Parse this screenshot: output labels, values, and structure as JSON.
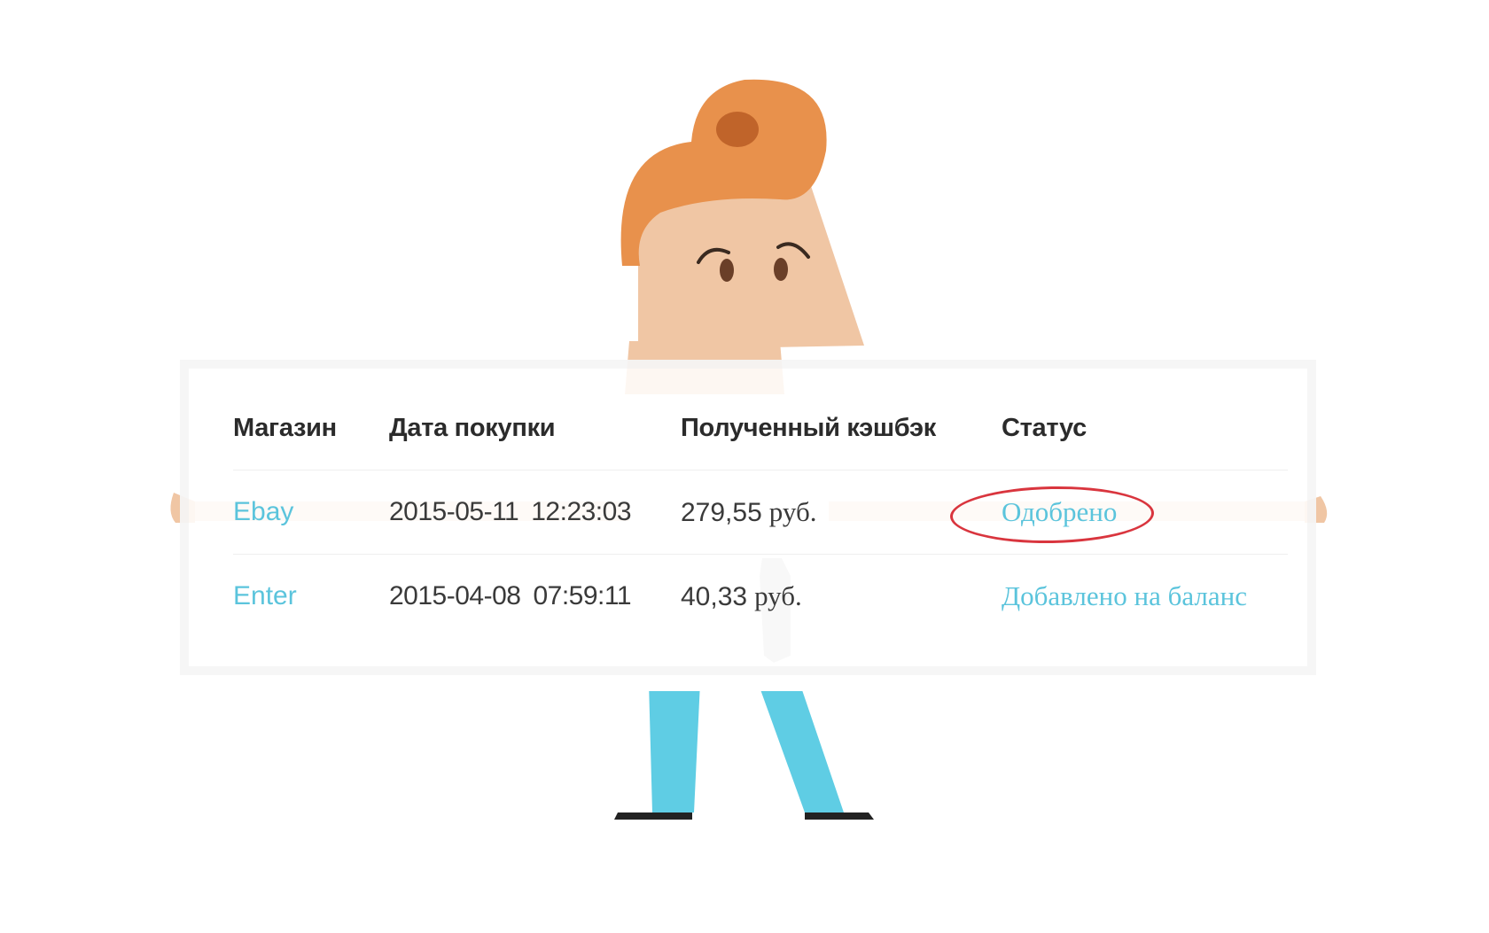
{
  "table": {
    "headers": {
      "store": "Магазин",
      "date": "Дата покупки",
      "cashback": "Полученный кэшбэк",
      "status": "Статус"
    },
    "rows": [
      {
        "store": "Ebay",
        "date": "2015-05-11",
        "time": "12:23:03",
        "amount": "279,55",
        "currency": "руб.",
        "status": "Одобрено"
      },
      {
        "store": "Enter",
        "date": "2015-04-08",
        "time": "07:59:11",
        "amount": "40,33",
        "currency": "руб.",
        "status": "Добавлено на баланс"
      }
    ]
  },
  "colors": {
    "link": "#5bc4dc",
    "highlight": "#d9353e",
    "hair": "#e8914c",
    "skin": "#f0c6a4",
    "pants": "#5fcde4"
  },
  "illustration": {
    "character": "cartoon-man-holding-table",
    "highlighted_status": "Одобрено"
  }
}
